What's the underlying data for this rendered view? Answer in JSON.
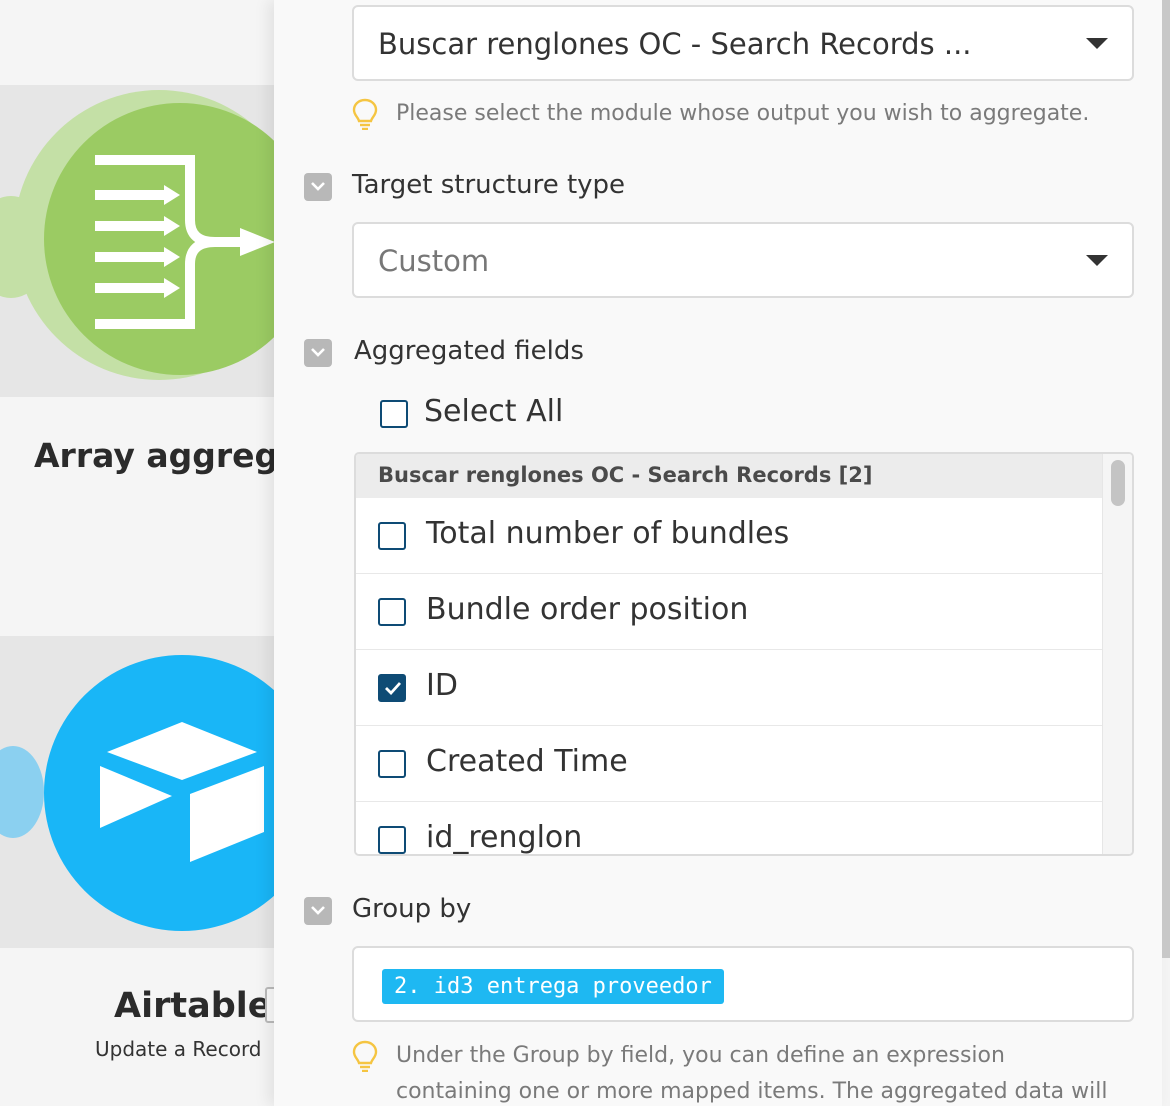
{
  "canvas": {
    "modules": [
      {
        "title": "Array aggrega",
        "subtitle": "",
        "icon": "array-aggregator-icon",
        "color": "#9bcb63"
      },
      {
        "title": "Airtable",
        "subtitle": "Update a Record",
        "icon": "airtable-icon",
        "color": "#19b6f7"
      }
    ]
  },
  "panel": {
    "source_module": {
      "value": "Buscar renglones OC - Search Records ...",
      "hint": "Please select the module whose output you wish to aggregate."
    },
    "target_structure": {
      "label": "Target structure type",
      "value": "Custom"
    },
    "aggregated_fields": {
      "label": "Aggregated fields",
      "select_all": "Select All",
      "group_header": "Buscar renglones OC - Search Records [2]",
      "items": [
        {
          "label": "Total number of bundles",
          "checked": false
        },
        {
          "label": "Bundle order position",
          "checked": false
        },
        {
          "label": "ID",
          "checked": true
        },
        {
          "label": "Created Time",
          "checked": false
        },
        {
          "label": "id_renglon",
          "checked": false
        }
      ]
    },
    "group_by": {
      "label": "Group by",
      "token": "2. id3 entrega proveedor",
      "hint": "Under the Group by field, you can define an expression containing one or more mapped items. The aggregated data will"
    }
  },
  "colors": {
    "accent": "#0e4b75",
    "token": "#1eb8f2",
    "aggregator": "#9bcb63",
    "airtable": "#19b6f7"
  }
}
